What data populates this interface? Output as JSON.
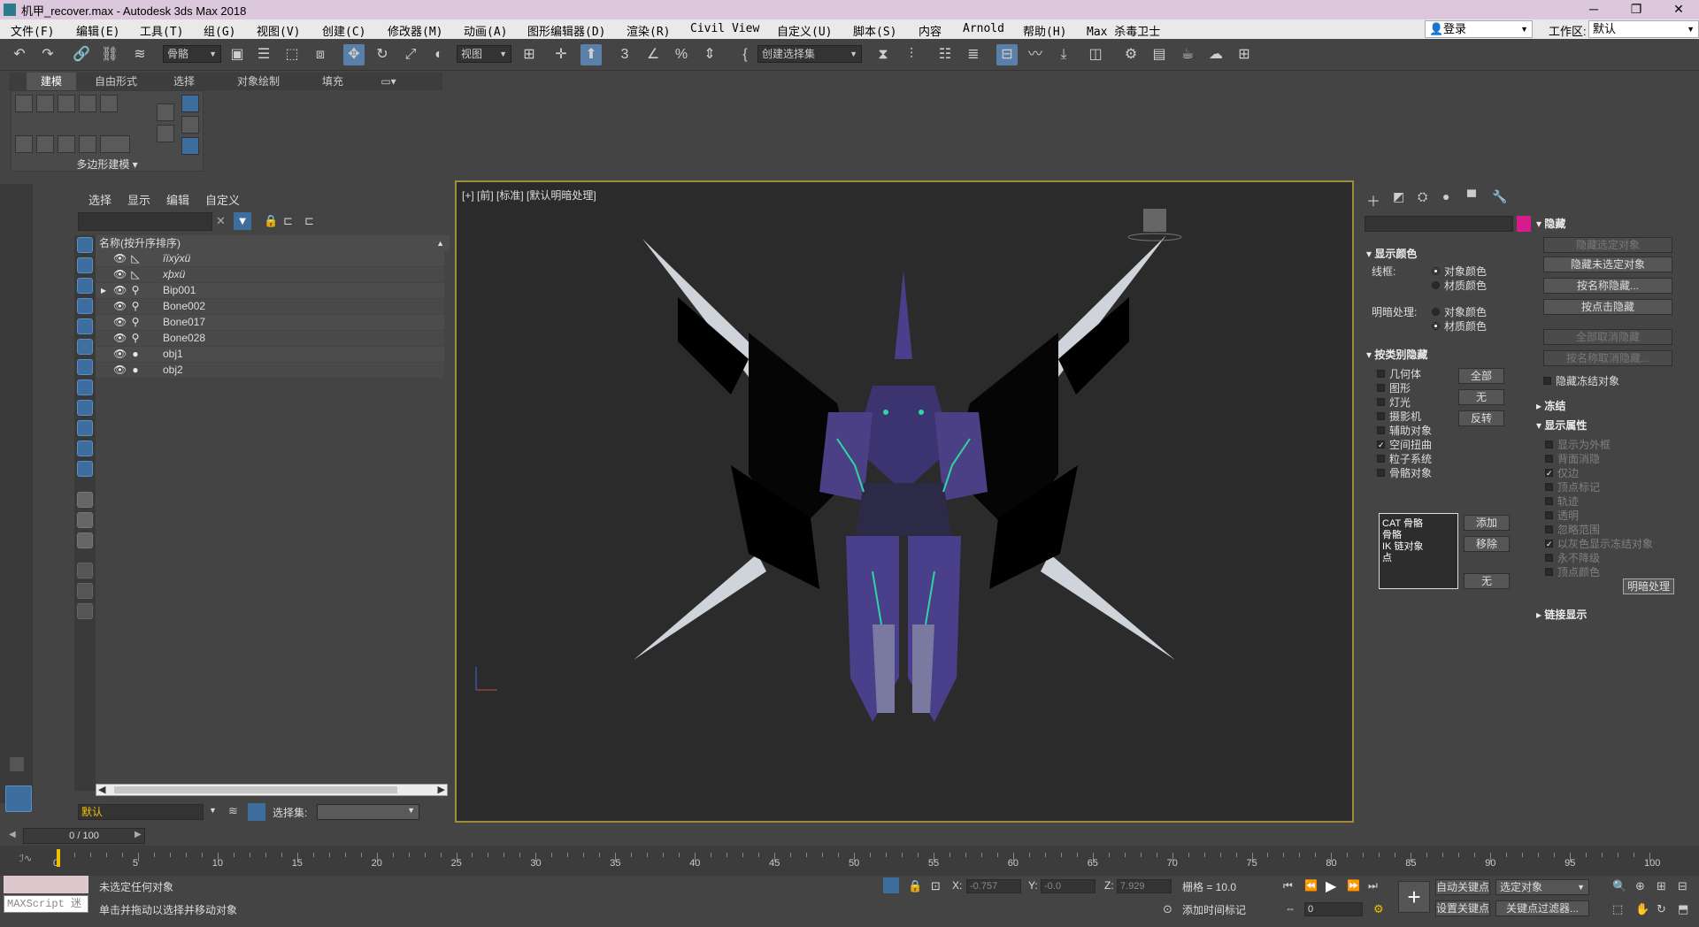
{
  "window": {
    "title": "机甲_recover.max - Autodesk 3ds Max 2018",
    "minimize": "─",
    "restore": "❐",
    "close": "✕"
  },
  "menu": [
    "文件(F)",
    "编辑(E)",
    "工具(T)",
    "组(G)",
    "视图(V)",
    "创建(C)",
    "修改器(M)",
    "动画(A)",
    "图形编辑器(D)",
    "渲染(R)",
    "Civil View",
    "自定义(U)",
    "脚本(S)",
    "内容",
    "Arnold",
    "帮助(H)",
    "Max 杀毒卫士"
  ],
  "account": {
    "login": "登录",
    "workspace_label": "工作区:",
    "workspace_value": "默认"
  },
  "toolbar": {
    "selection_filter": "骨骼",
    "reference_coord": "视图",
    "named_selection": "创建选择集"
  },
  "ribbon": {
    "tabs": [
      "建模",
      "自由形式",
      "选择",
      "对象绘制",
      "填充"
    ],
    "group_label": "多边形建模 ▾"
  },
  "scene_explorer": {
    "tabs": [
      "选择",
      "显示",
      "编辑",
      "自定义"
    ],
    "column_header": "名称(按升序排序)",
    "items": [
      {
        "name": "ïïxýxü",
        "type": "bone"
      },
      {
        "name": "xþxü",
        "type": "bone"
      },
      {
        "name": "Bip001",
        "type": "biped"
      },
      {
        "name": "Bone002",
        "type": "biped"
      },
      {
        "name": "Bone017",
        "type": "biped"
      },
      {
        "name": "Bone028",
        "type": "biped"
      },
      {
        "name": "obj1",
        "type": "geometry"
      },
      {
        "name": "obj2",
        "type": "geometry"
      }
    ],
    "layer": "默认",
    "selection_set_label": "选择集:"
  },
  "viewport": {
    "label": "[+] [前] [标准] [默认明暗处理]"
  },
  "command_panel": {
    "rollout_hide": "隐藏",
    "hide_buttons": [
      "隐藏选定对象",
      "隐藏未选定对象",
      "按名称隐藏...",
      "按点击隐藏",
      "全部取消隐藏",
      "按名称取消隐藏..."
    ],
    "hide_frozen": "隐藏冻结对象",
    "display_color": "显示颜色",
    "wireframe_label": "线框:",
    "shaded_label": "明暗处理:",
    "object_color": "对象颜色",
    "material_color": "材质颜色",
    "hide_by_category": "按类别隐藏",
    "categories": [
      {
        "label": "几何体",
        "checked": false
      },
      {
        "label": "图形",
        "checked": false
      },
      {
        "label": "灯光",
        "checked": false
      },
      {
        "label": "摄影机",
        "checked": false
      },
      {
        "label": "辅助对象",
        "checked": false
      },
      {
        "label": "空间扭曲",
        "checked": true
      },
      {
        "label": "粒子系统",
        "checked": false
      },
      {
        "label": "骨骼对象",
        "checked": false
      }
    ],
    "cat_buttons": [
      "全部",
      "无",
      "反转"
    ],
    "list_items": [
      "CAT 骨骼",
      "骨骼",
      "IK 链对象",
      "点"
    ],
    "list_buttons": [
      "添加",
      "移除",
      "无"
    ],
    "freeze": "冻结",
    "display_properties": "显示属性",
    "props": [
      {
        "label": "显示为外框",
        "checked": false
      },
      {
        "label": "背面消隐",
        "checked": false
      },
      {
        "label": "仅边",
        "checked": true
      },
      {
        "label": "顶点标记",
        "checked": false
      },
      {
        "label": "轨迹",
        "checked": false
      },
      {
        "label": "透明",
        "checked": false
      },
      {
        "label": "忽略范围",
        "checked": false
      },
      {
        "label": "以灰色显示冻结对象",
        "checked": true
      },
      {
        "label": "永不降级",
        "checked": false
      },
      {
        "label": "顶点颜色",
        "checked": false
      }
    ],
    "shading_button": "明暗处理",
    "link_display": "链接显示"
  },
  "time": {
    "frame_counter": "0 / 100",
    "ticks": [
      0,
      5,
      10,
      15,
      20,
      25,
      30,
      35,
      40,
      45,
      50,
      55,
      60,
      65,
      70,
      75,
      80,
      85,
      90,
      95,
      100
    ]
  },
  "status": {
    "maxscript": "MAXScript 迷",
    "line1": "未选定任何对象",
    "line2": "单击并拖动以选择并移动对象",
    "x_label": "X:",
    "x_value": "-0.757",
    "y_label": "Y:",
    "y_value": "-0.0",
    "z_label": "Z:",
    "z_value": "7.929",
    "grid": "栅格 = 10.0",
    "add_time_tag": "添加时间标记",
    "auto_key": "自动关键点",
    "set_key": "设置关键点",
    "selected_object": "选定对象",
    "key_filters": "关键点过滤器...",
    "frame": "0"
  }
}
